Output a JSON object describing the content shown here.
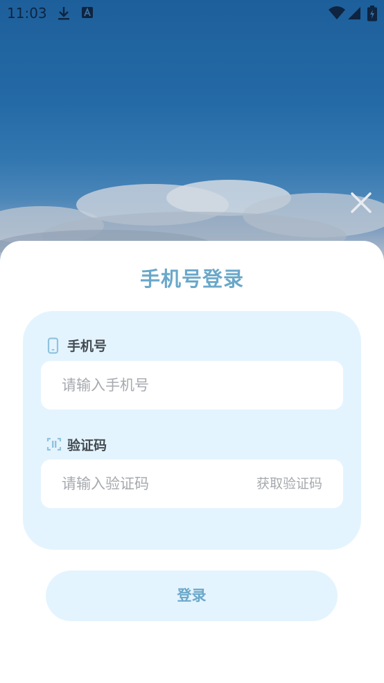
{
  "status_bar": {
    "time": "11:03",
    "icons": [
      "download-icon",
      "font-a-icon",
      "wifi-icon",
      "signal-icon",
      "battery-charging-icon"
    ]
  },
  "close_icon": "close-icon",
  "sheet": {
    "title": "手机号登录",
    "phone": {
      "label": "手机号",
      "icon": "phone-icon",
      "placeholder": "请输入手机号"
    },
    "code": {
      "label": "验证码",
      "icon": "scan-code-icon",
      "placeholder": "请输入验证码",
      "get_code_label": "获取验证码"
    },
    "login_label": "登录"
  },
  "colors": {
    "accent": "#6aa8c9",
    "card_bg": "#e4f4fe",
    "placeholder": "#a6a9ae",
    "label": "#444b52"
  }
}
